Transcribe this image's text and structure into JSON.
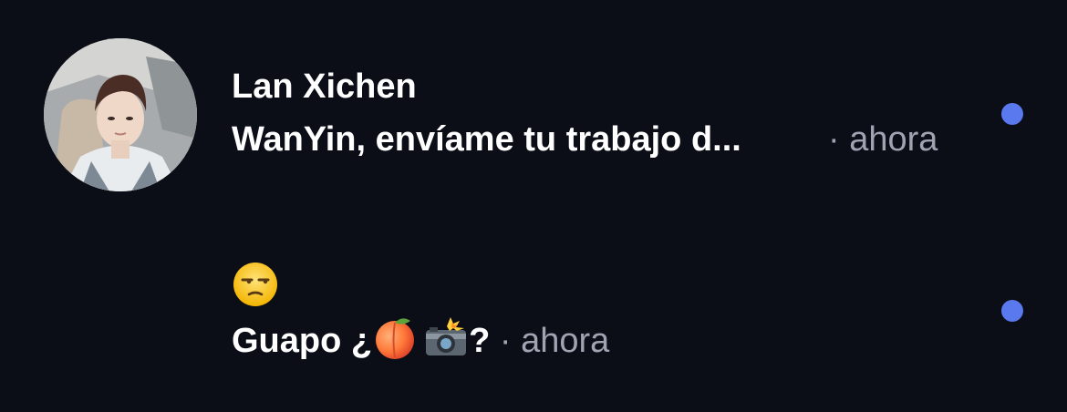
{
  "notifications": [
    {
      "sender": "Lan Xichen",
      "preview": "WanYin, envíame tu trabajo d...",
      "separator": "·",
      "time": "ahora",
      "avatar": "portrait-avatar",
      "unread": true
    },
    {
      "emoji_line": "unamused-face-emoji",
      "preview_prefix": "Guapo ¿",
      "preview_suffix": "?",
      "inline_emojis": [
        "peach-emoji",
        "camera-flash-emoji"
      ],
      "separator": "·",
      "time": "ahora",
      "unread": true
    }
  ],
  "colors": {
    "background": "#0b0d17",
    "text": "#ffffff",
    "time": "#9fa3b2",
    "unread_dot": "#5b79ee"
  }
}
